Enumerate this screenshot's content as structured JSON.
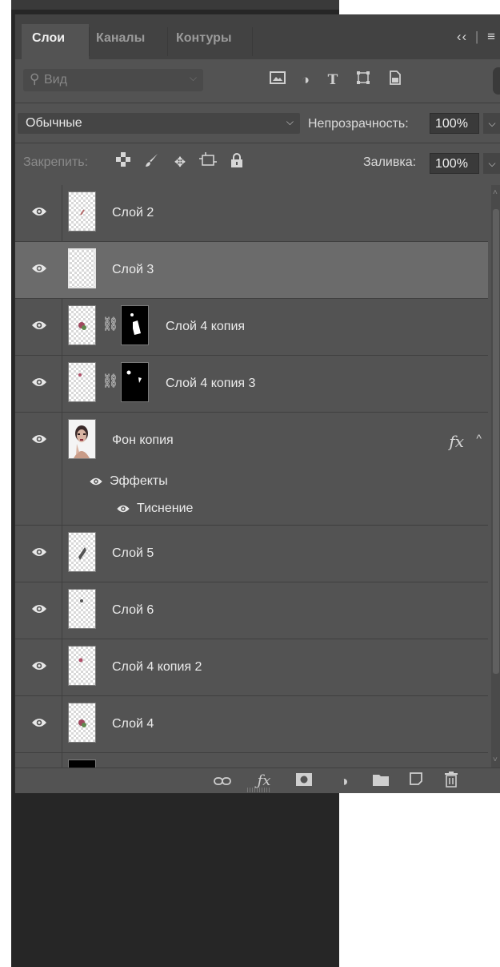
{
  "tabs": [
    {
      "label": "Слои",
      "active": true
    },
    {
      "label": "Каналы",
      "active": false
    },
    {
      "label": "Контуры",
      "active": false
    }
  ],
  "tabbar_right": {
    "collapse": "‹‹",
    "sep": "|",
    "menu": "≡"
  },
  "filter": {
    "placeholder": "Вид",
    "icons": [
      "image-filter-icon",
      "adjustment-filter-icon",
      "type-filter-icon",
      "shape-filter-icon",
      "smart-object-filter-icon"
    ]
  },
  "blend": {
    "mode": "Обычные",
    "opacity_label": "Непрозрачность:",
    "opacity_value": "100%"
  },
  "lock": {
    "label": "Закрепить:",
    "icons": [
      "lock-transparency-icon",
      "lock-image-icon",
      "lock-position-icon",
      "lock-artboard-icon",
      "lock-all-icon"
    ],
    "fill_label": "Заливка:",
    "fill_value": "100%"
  },
  "layers": [
    {
      "name": "Слой 2",
      "selected": false,
      "mask": false
    },
    {
      "name": "Слой 3",
      "selected": true,
      "mask": false
    },
    {
      "name": "Слой 4 копия",
      "selected": false,
      "mask": true
    },
    {
      "name": "Слой 4 копия 3",
      "selected": false,
      "mask": true
    },
    {
      "name": "Фон копия",
      "selected": false,
      "mask": false,
      "fx": "fx",
      "effects_label": "Эффекты",
      "effect": "Тиснение"
    },
    {
      "name": "Слой 5",
      "selected": false,
      "mask": false
    },
    {
      "name": "Слой 6",
      "selected": false,
      "mask": false
    },
    {
      "name": "Слой 4 копия 2",
      "selected": false,
      "mask": false
    },
    {
      "name": "Слой 4",
      "selected": false,
      "mask": false
    }
  ],
  "bottom_icons": [
    "link-layers-icon",
    "fx-icon",
    "add-mask-icon",
    "adjustment-layer-icon",
    "new-group-icon",
    "new-layer-icon",
    "delete-layer-icon"
  ]
}
